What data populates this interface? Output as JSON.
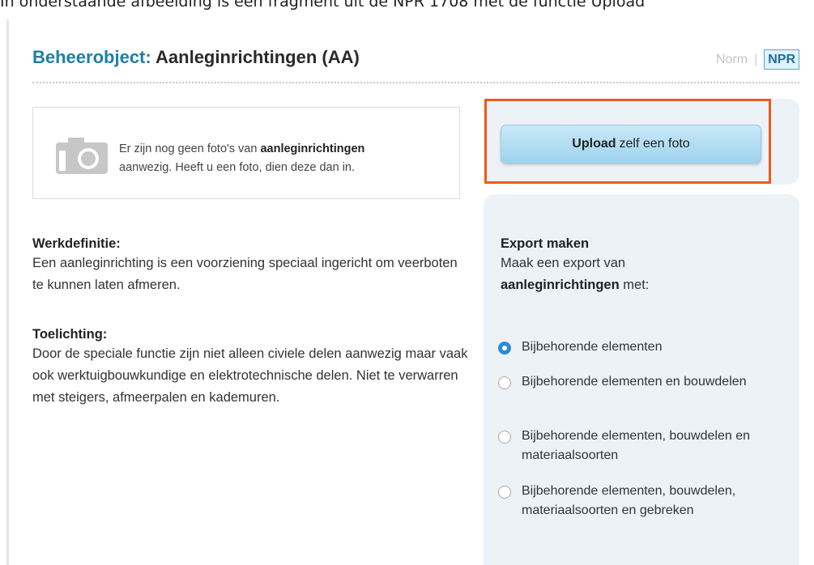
{
  "caption": "In onderstaande afbeelding is een fragment uit de NPR 1708 met de functie Upload",
  "header": {
    "title_prefix": "Beheerobject:",
    "title_rest": "Aanleginrichtingen (AA)",
    "view_norm": "Norm",
    "view_separator": "|",
    "view_npr": "NPR"
  },
  "photo": {
    "icon": "camera-icon",
    "message_start": "Er zijn nog geen foto's van ",
    "message_bold": "aanleginrichtingen",
    "message_end": "aanwezig. Heeft u een foto, dien deze dan in."
  },
  "upload": {
    "label_bold": "Upload",
    "label_rest": "zelf een foto"
  },
  "definition": {
    "heading": "Werkdefinitie:",
    "text": "Een aanleginrichting is een voorziening speciaal ingericht om veerboten te kunnen laten afmeren."
  },
  "explanation": {
    "heading": "Toelichting:",
    "text": "Door de speciale functie zijn niet alleen civiele delen aanwezig maar vaak ook werktuigbouwkundige en elektrotechnische delen. Niet te verwarren met steigers, afmeerpalen en kademuren."
  },
  "export": {
    "heading": "Export maken",
    "desc_start": "Maak een export van",
    "desc_bold": "aanleginrichtingen",
    "desc_end": "met:",
    "options": [
      {
        "label": "Bijbehorende elementen",
        "checked": true
      },
      {
        "label": "Bijbehorende elementen en bouwdelen",
        "checked": false
      },
      {
        "label": "Bijbehorende elementen, bouwdelen en materiaalsoorten",
        "checked": false
      },
      {
        "label": "Bijbehorende elementen, bouwdelen, materiaalsoorten en gebreken",
        "checked": false
      }
    ]
  },
  "colors": {
    "title_accent": "#1f7fa6",
    "highlight_border": "#ef5a1b",
    "panel_bg": "#ecf2f6",
    "radio_selected": "#2d8bd6"
  }
}
